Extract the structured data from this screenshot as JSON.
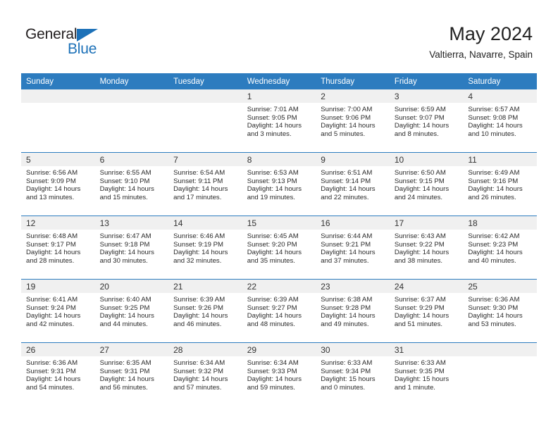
{
  "brand": {
    "name_top": "General",
    "name_bottom": "Blue",
    "triangle_color": "#1c71b8"
  },
  "header": {
    "title": "May 2024",
    "subtitle": "Valtierra, Navarre, Spain"
  },
  "theme": {
    "header_bg": "#2d7cbf",
    "header_text": "#ffffff",
    "daynum_band_bg": "#f0f0f0",
    "grid_line": "#2d7cbf",
    "body_text": "#2a2a2a"
  },
  "weekday_headers": [
    "Sunday",
    "Monday",
    "Tuesday",
    "Wednesday",
    "Thursday",
    "Friday",
    "Saturday"
  ],
  "labels": {
    "sunrise_prefix": "Sunrise:",
    "sunset_prefix": "Sunset:",
    "daylight_prefix": "Daylight:"
  },
  "weeks": [
    [
      {
        "day": "",
        "empty": true
      },
      {
        "day": "",
        "empty": true
      },
      {
        "day": "",
        "empty": true
      },
      {
        "day": "1",
        "sunrise": "Sunrise: 7:01 AM",
        "sunset": "Sunset: 9:05 PM",
        "daylight_1": "Daylight: 14 hours",
        "daylight_2": "and 3 minutes."
      },
      {
        "day": "2",
        "sunrise": "Sunrise: 7:00 AM",
        "sunset": "Sunset: 9:06 PM",
        "daylight_1": "Daylight: 14 hours",
        "daylight_2": "and 5 minutes."
      },
      {
        "day": "3",
        "sunrise": "Sunrise: 6:59 AM",
        "sunset": "Sunset: 9:07 PM",
        "daylight_1": "Daylight: 14 hours",
        "daylight_2": "and 8 minutes."
      },
      {
        "day": "4",
        "sunrise": "Sunrise: 6:57 AM",
        "sunset": "Sunset: 9:08 PM",
        "daylight_1": "Daylight: 14 hours",
        "daylight_2": "and 10 minutes."
      }
    ],
    [
      {
        "day": "5",
        "sunrise": "Sunrise: 6:56 AM",
        "sunset": "Sunset: 9:09 PM",
        "daylight_1": "Daylight: 14 hours",
        "daylight_2": "and 13 minutes."
      },
      {
        "day": "6",
        "sunrise": "Sunrise: 6:55 AM",
        "sunset": "Sunset: 9:10 PM",
        "daylight_1": "Daylight: 14 hours",
        "daylight_2": "and 15 minutes."
      },
      {
        "day": "7",
        "sunrise": "Sunrise: 6:54 AM",
        "sunset": "Sunset: 9:11 PM",
        "daylight_1": "Daylight: 14 hours",
        "daylight_2": "and 17 minutes."
      },
      {
        "day": "8",
        "sunrise": "Sunrise: 6:53 AM",
        "sunset": "Sunset: 9:13 PM",
        "daylight_1": "Daylight: 14 hours",
        "daylight_2": "and 19 minutes."
      },
      {
        "day": "9",
        "sunrise": "Sunrise: 6:51 AM",
        "sunset": "Sunset: 9:14 PM",
        "daylight_1": "Daylight: 14 hours",
        "daylight_2": "and 22 minutes."
      },
      {
        "day": "10",
        "sunrise": "Sunrise: 6:50 AM",
        "sunset": "Sunset: 9:15 PM",
        "daylight_1": "Daylight: 14 hours",
        "daylight_2": "and 24 minutes."
      },
      {
        "day": "11",
        "sunrise": "Sunrise: 6:49 AM",
        "sunset": "Sunset: 9:16 PM",
        "daylight_1": "Daylight: 14 hours",
        "daylight_2": "and 26 minutes."
      }
    ],
    [
      {
        "day": "12",
        "sunrise": "Sunrise: 6:48 AM",
        "sunset": "Sunset: 9:17 PM",
        "daylight_1": "Daylight: 14 hours",
        "daylight_2": "and 28 minutes."
      },
      {
        "day": "13",
        "sunrise": "Sunrise: 6:47 AM",
        "sunset": "Sunset: 9:18 PM",
        "daylight_1": "Daylight: 14 hours",
        "daylight_2": "and 30 minutes."
      },
      {
        "day": "14",
        "sunrise": "Sunrise: 6:46 AM",
        "sunset": "Sunset: 9:19 PM",
        "daylight_1": "Daylight: 14 hours",
        "daylight_2": "and 32 minutes."
      },
      {
        "day": "15",
        "sunrise": "Sunrise: 6:45 AM",
        "sunset": "Sunset: 9:20 PM",
        "daylight_1": "Daylight: 14 hours",
        "daylight_2": "and 35 minutes."
      },
      {
        "day": "16",
        "sunrise": "Sunrise: 6:44 AM",
        "sunset": "Sunset: 9:21 PM",
        "daylight_1": "Daylight: 14 hours",
        "daylight_2": "and 37 minutes."
      },
      {
        "day": "17",
        "sunrise": "Sunrise: 6:43 AM",
        "sunset": "Sunset: 9:22 PM",
        "daylight_1": "Daylight: 14 hours",
        "daylight_2": "and 38 minutes."
      },
      {
        "day": "18",
        "sunrise": "Sunrise: 6:42 AM",
        "sunset": "Sunset: 9:23 PM",
        "daylight_1": "Daylight: 14 hours",
        "daylight_2": "and 40 minutes."
      }
    ],
    [
      {
        "day": "19",
        "sunrise": "Sunrise: 6:41 AM",
        "sunset": "Sunset: 9:24 PM",
        "daylight_1": "Daylight: 14 hours",
        "daylight_2": "and 42 minutes."
      },
      {
        "day": "20",
        "sunrise": "Sunrise: 6:40 AM",
        "sunset": "Sunset: 9:25 PM",
        "daylight_1": "Daylight: 14 hours",
        "daylight_2": "and 44 minutes."
      },
      {
        "day": "21",
        "sunrise": "Sunrise: 6:39 AM",
        "sunset": "Sunset: 9:26 PM",
        "daylight_1": "Daylight: 14 hours",
        "daylight_2": "and 46 minutes."
      },
      {
        "day": "22",
        "sunrise": "Sunrise: 6:39 AM",
        "sunset": "Sunset: 9:27 PM",
        "daylight_1": "Daylight: 14 hours",
        "daylight_2": "and 48 minutes."
      },
      {
        "day": "23",
        "sunrise": "Sunrise: 6:38 AM",
        "sunset": "Sunset: 9:28 PM",
        "daylight_1": "Daylight: 14 hours",
        "daylight_2": "and 49 minutes."
      },
      {
        "day": "24",
        "sunrise": "Sunrise: 6:37 AM",
        "sunset": "Sunset: 9:29 PM",
        "daylight_1": "Daylight: 14 hours",
        "daylight_2": "and 51 minutes."
      },
      {
        "day": "25",
        "sunrise": "Sunrise: 6:36 AM",
        "sunset": "Sunset: 9:30 PM",
        "daylight_1": "Daylight: 14 hours",
        "daylight_2": "and 53 minutes."
      }
    ],
    [
      {
        "day": "26",
        "sunrise": "Sunrise: 6:36 AM",
        "sunset": "Sunset: 9:31 PM",
        "daylight_1": "Daylight: 14 hours",
        "daylight_2": "and 54 minutes."
      },
      {
        "day": "27",
        "sunrise": "Sunrise: 6:35 AM",
        "sunset": "Sunset: 9:31 PM",
        "daylight_1": "Daylight: 14 hours",
        "daylight_2": "and 56 minutes."
      },
      {
        "day": "28",
        "sunrise": "Sunrise: 6:34 AM",
        "sunset": "Sunset: 9:32 PM",
        "daylight_1": "Daylight: 14 hours",
        "daylight_2": "and 57 minutes."
      },
      {
        "day": "29",
        "sunrise": "Sunrise: 6:34 AM",
        "sunset": "Sunset: 9:33 PM",
        "daylight_1": "Daylight: 14 hours",
        "daylight_2": "and 59 minutes."
      },
      {
        "day": "30",
        "sunrise": "Sunrise: 6:33 AM",
        "sunset": "Sunset: 9:34 PM",
        "daylight_1": "Daylight: 15 hours",
        "daylight_2": "and 0 minutes."
      },
      {
        "day": "31",
        "sunrise": "Sunrise: 6:33 AM",
        "sunset": "Sunset: 9:35 PM",
        "daylight_1": "Daylight: 15 hours",
        "daylight_2": "and 1 minute."
      },
      {
        "day": "",
        "empty": true
      }
    ]
  ]
}
